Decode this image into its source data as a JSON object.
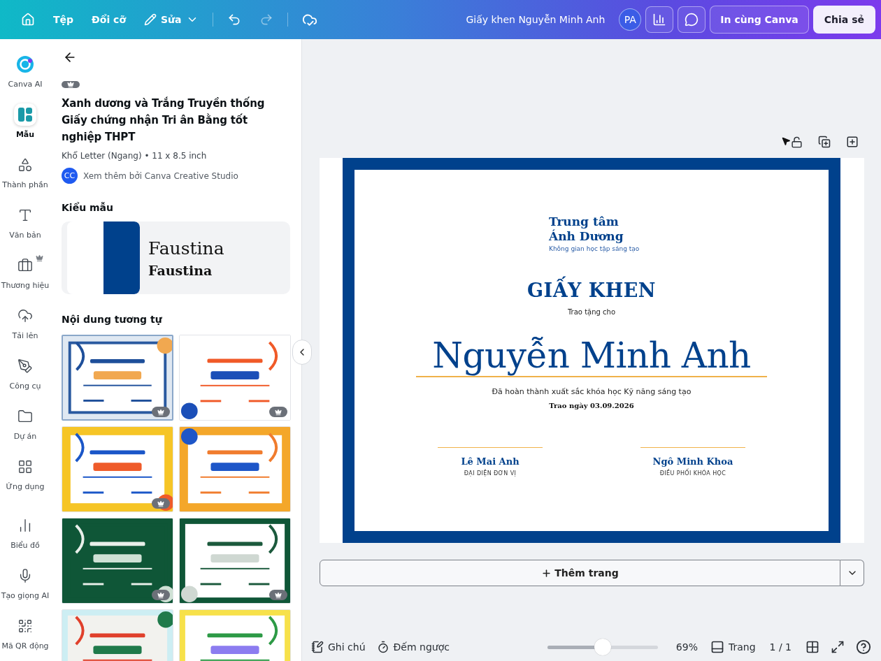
{
  "topbar": {
    "menu": [
      {
        "label": "Tệp"
      },
      {
        "label": "Đổi cỡ"
      }
    ],
    "edit_menu": "Sửa",
    "redo_disabled": true,
    "doc_title": "Giấy khen Nguyễn Minh Anh",
    "avatar": "PA",
    "print_button": "In cùng Canva",
    "share_button": "Chia sẻ"
  },
  "rail": {
    "items": [
      {
        "label": "Canva AI",
        "selected": false,
        "premium": false
      },
      {
        "label": "Mẫu",
        "selected": true,
        "premium": false
      },
      {
        "label": "Thành phần",
        "selected": false,
        "premium": false
      },
      {
        "label": "Văn bản",
        "selected": false,
        "premium": false
      },
      {
        "label": "Thương hiệu",
        "selected": false,
        "premium": true
      },
      {
        "label": "Tải lên",
        "selected": false,
        "premium": false
      },
      {
        "label": "Công cụ",
        "selected": false,
        "premium": false
      },
      {
        "label": "Dự án",
        "selected": false,
        "premium": false
      },
      {
        "label": "Ứng dụng",
        "selected": false,
        "premium": false
      }
    ],
    "more_items": [
      {
        "label": "Biểu đồ",
        "selected": false,
        "premium": false
      },
      {
        "label": "Tạo giọng AI",
        "selected": false,
        "premium": false
      },
      {
        "label": "Mã QR động",
        "selected": false,
        "premium": false
      }
    ]
  },
  "panel": {
    "premium": true,
    "title": "Xanh dương và Trắng Truyền thống Giấy chứng nhận Tri ân Bằng tốt nghiệp THPT",
    "size": "Khổ Letter (Ngang) • 11 x 8.5 inch",
    "author_avatar": "CC",
    "author_link": "Xem thêm bởi Canva Creative Studio",
    "style_heading": "Kiểu mẫu",
    "font_sample": {
      "regular": "Faustina",
      "bold": "Faustina"
    },
    "similar_heading": "Nội dung tương tự",
    "thumbnails": [
      {
        "kind": "picture",
        "premium": true,
        "selected": true
      },
      {
        "kind": "picture",
        "premium": true,
        "selected": false
      },
      {
        "kind": "picture",
        "premium": true,
        "selected": false
      },
      {
        "kind": "picture",
        "premium": false,
        "selected": false
      },
      {
        "kind": "picture",
        "premium": true,
        "selected": false
      },
      {
        "kind": "picture",
        "premium": true,
        "selected": false
      },
      {
        "kind": "picture",
        "premium": false,
        "selected": false
      },
      {
        "kind": "picture",
        "premium": false,
        "selected": false
      }
    ]
  },
  "certificate": {
    "org_name": "Trung tâm Ánh Dương",
    "tagline": "Không gian học tập sáng tạo",
    "title": "GIẤY KHEN",
    "subtitle": "Trao tặng cho",
    "recipient": "Nguyễn Minh Anh",
    "description": "Đã hoàn thành xuất sắc khóa học Kỹ năng sáng tạo",
    "date": "Trao ngày 03.09.2026",
    "signers": [
      {
        "name": "Lê Mai Anh",
        "role": "ĐẠI DIỆN ĐƠN VỊ"
      },
      {
        "name": "Ngô Minh Khoa",
        "role": "ĐIỀU PHỐI KHÓA HỌC"
      }
    ]
  },
  "add_page": "Thêm trang",
  "bottom_bar": {
    "notes": "Ghi chú",
    "timer": "Đếm ngược",
    "zoom": {
      "level": 0.5,
      "reading": "69%"
    },
    "pages_label": "Trang",
    "page_count": "1 / 1"
  }
}
